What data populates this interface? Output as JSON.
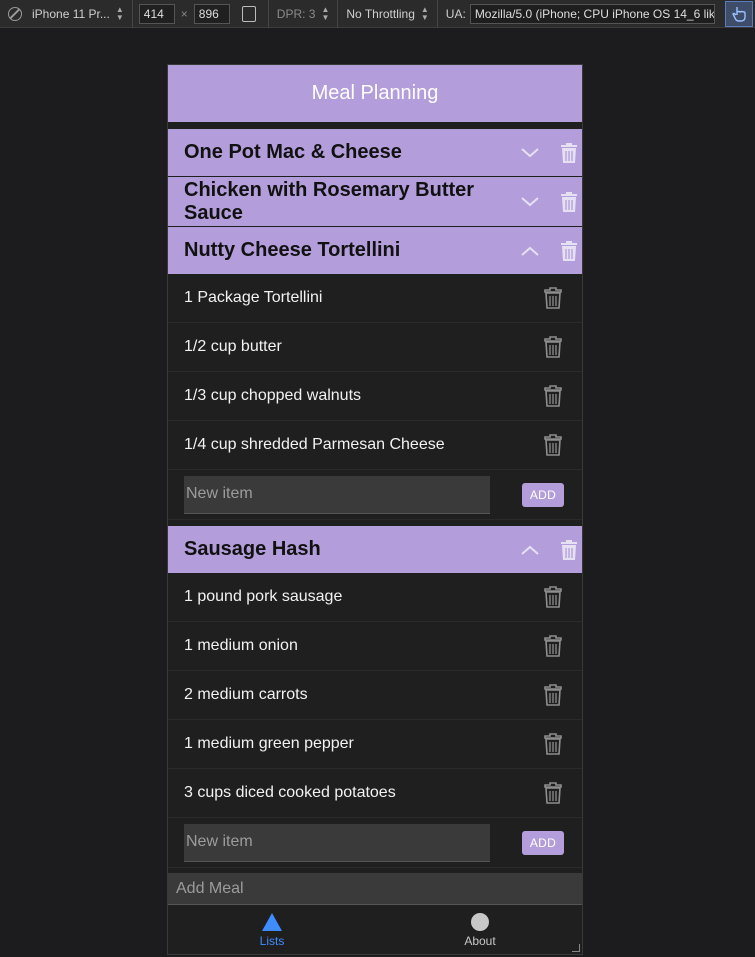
{
  "devtools": {
    "device": "iPhone 11 Pr...",
    "width": "414",
    "height": "896",
    "times": "×",
    "dpr": "DPR: 3",
    "throttle": "No Throttling",
    "ua_label": "UA:",
    "ua_value": "Mozilla/5.0 (iPhone; CPU iPhone OS 14_6 like Mac"
  },
  "app": {
    "title": "Meal Planning",
    "accent": "#b39ddb",
    "meals": [
      {
        "title": "One Pot Mac & Cheese",
        "expanded": false
      },
      {
        "title": "Chicken with Rosemary Butter Sauce",
        "expanded": false
      },
      {
        "title": "Nutty Cheese Tortellini",
        "expanded": true,
        "items": [
          "1 Package Tortellini",
          "1/2 cup butter",
          "1/3 cup chopped walnuts",
          "1/4 cup shredded Parmesan Cheese"
        ],
        "new_item_placeholder": "New item",
        "add_label": "ADD"
      },
      {
        "title": "Sausage Hash",
        "expanded": true,
        "items": [
          "1 pound pork sausage",
          "1 medium onion",
          "2 medium carrots",
          "1 medium green pepper",
          "3 cups diced cooked potatoes"
        ],
        "new_item_placeholder": "New item",
        "add_label": "ADD"
      }
    ],
    "add_meal_placeholder": "Add Meal",
    "tabs": [
      {
        "label": "Lists",
        "icon": "triangle-icon",
        "active": true,
        "color": "#3f8cff"
      },
      {
        "label": "About",
        "icon": "circle-icon",
        "active": false
      }
    ]
  }
}
